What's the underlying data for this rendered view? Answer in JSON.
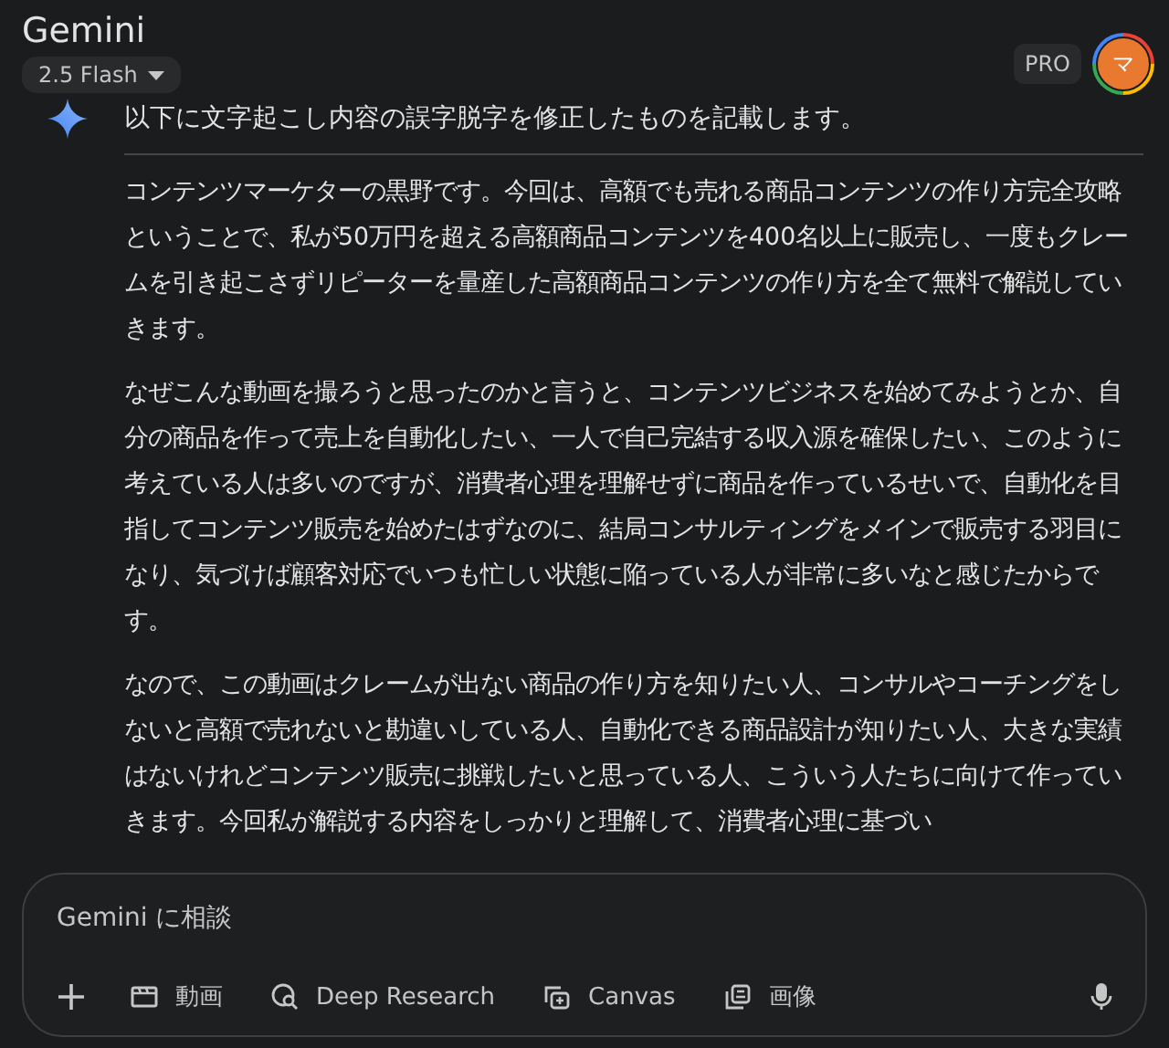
{
  "header": {
    "title": "Gemini",
    "model": "2.5 Flash",
    "badge": "PRO",
    "avatar": "マ"
  },
  "response": {
    "intro": "以下に文字起こし内容の誤字脱字を修正したものを記載します。",
    "paragraphs": [
      "コンテンツマーケターの黒野です。今回は、高額でも売れる商品コンテンツの作り方完全攻略ということで、私が50万円を超える高額商品コンテンツを400名以上に販売し、一度もクレームを引き起こさずリピーターを量産した高額商品コンテンツの作り方を全て無料で解説していきます。",
      "なぜこんな動画を撮ろうと思ったのかと言うと、コンテンツビジネスを始めてみようとか、自分の商品を作って売上を自動化したい、一人で自己完結する収入源を確保したい、このように考えている人は多いのですが、消費者心理を理解せずに商品を作っているせいで、自動化を目指してコンテンツ販売を始めたはずなのに、結局コンサルティングをメインで販売する羽目になり、気づけば顧客対応でいつも忙しい状態に陥っている人が非常に多いなと感じたからです。",
      "なので、この動画はクレームが出ない商品の作り方を知りたい人、コンサルやコーチングをしないと高額で売れないと勘違いしている人、自動化できる商品設計が知りたい人、大きな実績はないけれどコンテンツ販売に挑戦したいと思っている人、こういう人たちに向けて作っていきます。今回私が解説する内容をしっかりと理解して、消費者心理に基づい"
    ]
  },
  "composer": {
    "placeholder": "Gemini に相談",
    "tools": [
      {
        "kind": "video",
        "label": "動画"
      },
      {
        "kind": "research",
        "label": "Deep Research"
      },
      {
        "kind": "canvas",
        "label": "Canvas"
      },
      {
        "kind": "image",
        "label": "画像"
      }
    ]
  }
}
